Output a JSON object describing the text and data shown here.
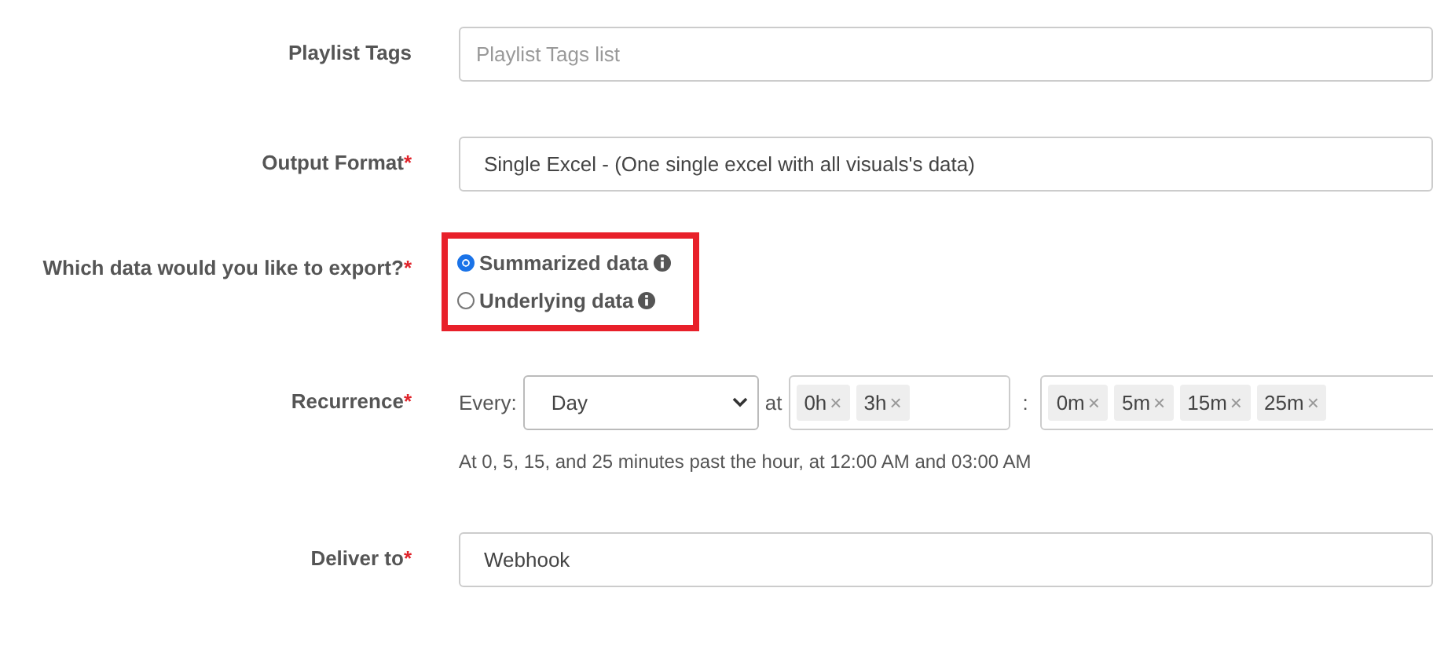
{
  "fields": [
    {
      "kind": "text",
      "label": "Playlist Tags",
      "placeholder": "Playlist Tags list"
    },
    {
      "kind": "select",
      "label": "Output Format",
      "required_mark": "*",
      "value": "Single Excel - (One single excel with all visuals's data)"
    },
    {
      "kind": "radio",
      "label": "Which data would you like to export?",
      "required_mark": "*",
      "highlighted": true,
      "options": [
        {
          "label": "Summarized data",
          "selected": true
        },
        {
          "label": "Underlying data",
          "selected": false
        }
      ]
    },
    {
      "kind": "recurrence",
      "label": "Recurrence",
      "required_mark": "*",
      "every_label": "Every:",
      "period": "Day",
      "at_label": "at",
      "separator": ":",
      "remove_glyph": "×",
      "hours": [
        "0h",
        "3h"
      ],
      "minutes": [
        "0m",
        "5m",
        "15m",
        "25m"
      ],
      "summary": "At 0, 5, 15, and 25 minutes past the hour, at 12:00 AM and 03:00 AM"
    },
    {
      "kind": "select",
      "label": "Deliver to",
      "required_mark": "*",
      "value": "Webhook"
    }
  ]
}
